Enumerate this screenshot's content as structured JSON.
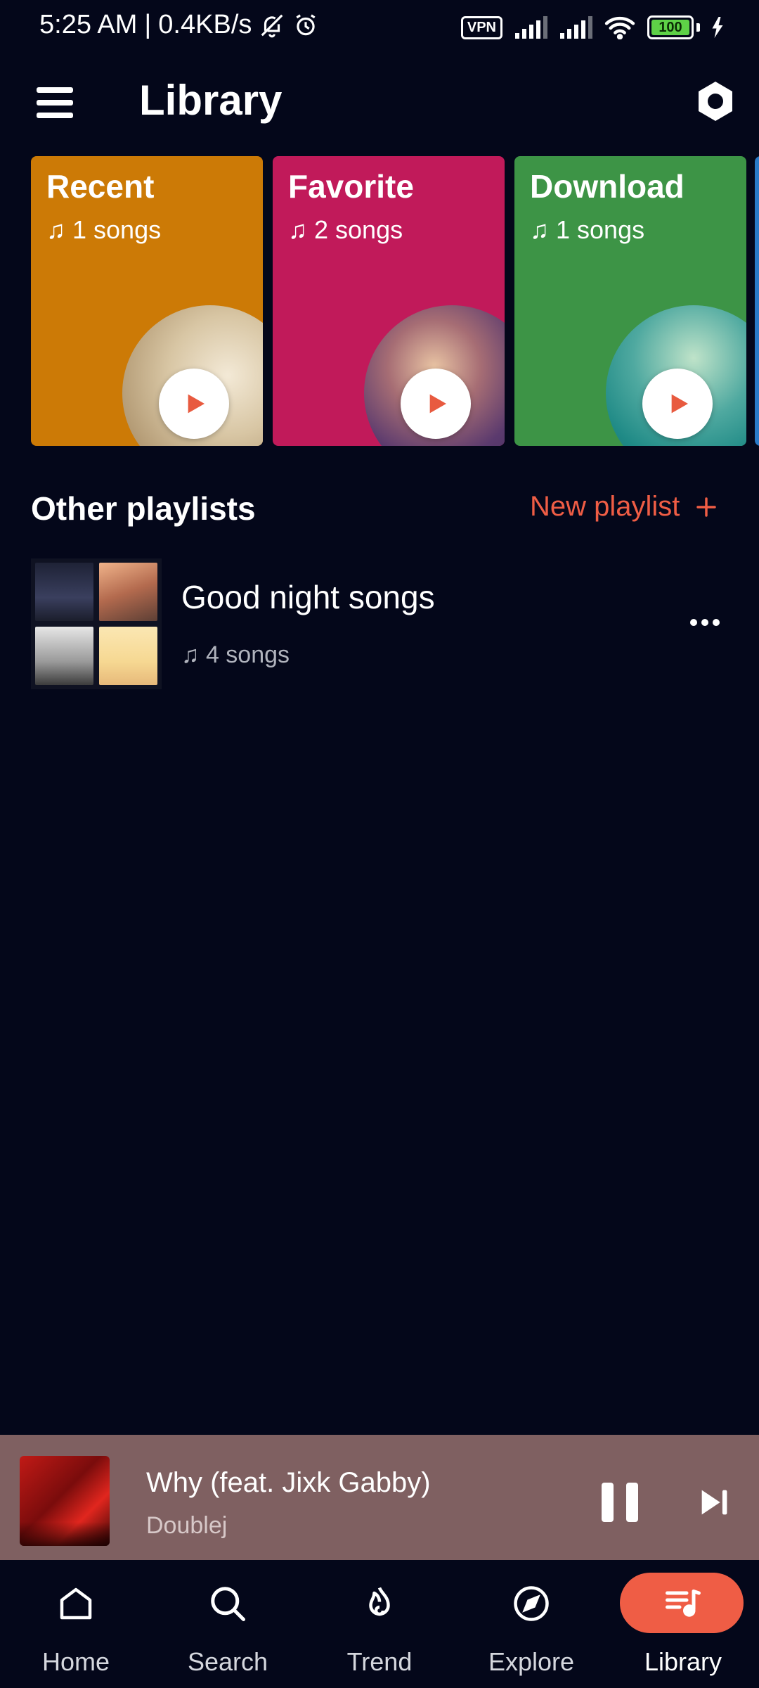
{
  "status_bar": {
    "time": "5:25 AM",
    "separator": "|",
    "speed": "0.4KB/s",
    "vpn": "VPN",
    "battery": "100"
  },
  "header": {
    "title": "Library"
  },
  "cards": [
    {
      "title": "Recent",
      "subtitle": "♫ 1 songs",
      "color": "#cc7a06"
    },
    {
      "title": "Favorite",
      "subtitle": "♫ 2 songs",
      "color": "#c11a5a"
    },
    {
      "title": "Download",
      "subtitle": "♫ 1 songs",
      "color": "#3d9446"
    }
  ],
  "playlists_section": {
    "title": "Other playlists",
    "new_label": "New playlist"
  },
  "playlists": [
    {
      "name": "Good night songs",
      "count": "♫ 4 songs"
    }
  ],
  "now_playing": {
    "title": "Why (feat. Jixk Gabby)",
    "artist": "Doublej"
  },
  "nav": [
    {
      "label": "Home",
      "icon": "home-icon"
    },
    {
      "label": "Search",
      "icon": "search-icon"
    },
    {
      "label": "Trend",
      "icon": "flame-icon"
    },
    {
      "label": "Explore",
      "icon": "compass-icon"
    },
    {
      "label": "Library",
      "icon": "library-icon",
      "active": true
    }
  ],
  "colors": {
    "background": "#04071a",
    "accent": "#ef5d45",
    "now_playing_bg": "#7f6061"
  }
}
